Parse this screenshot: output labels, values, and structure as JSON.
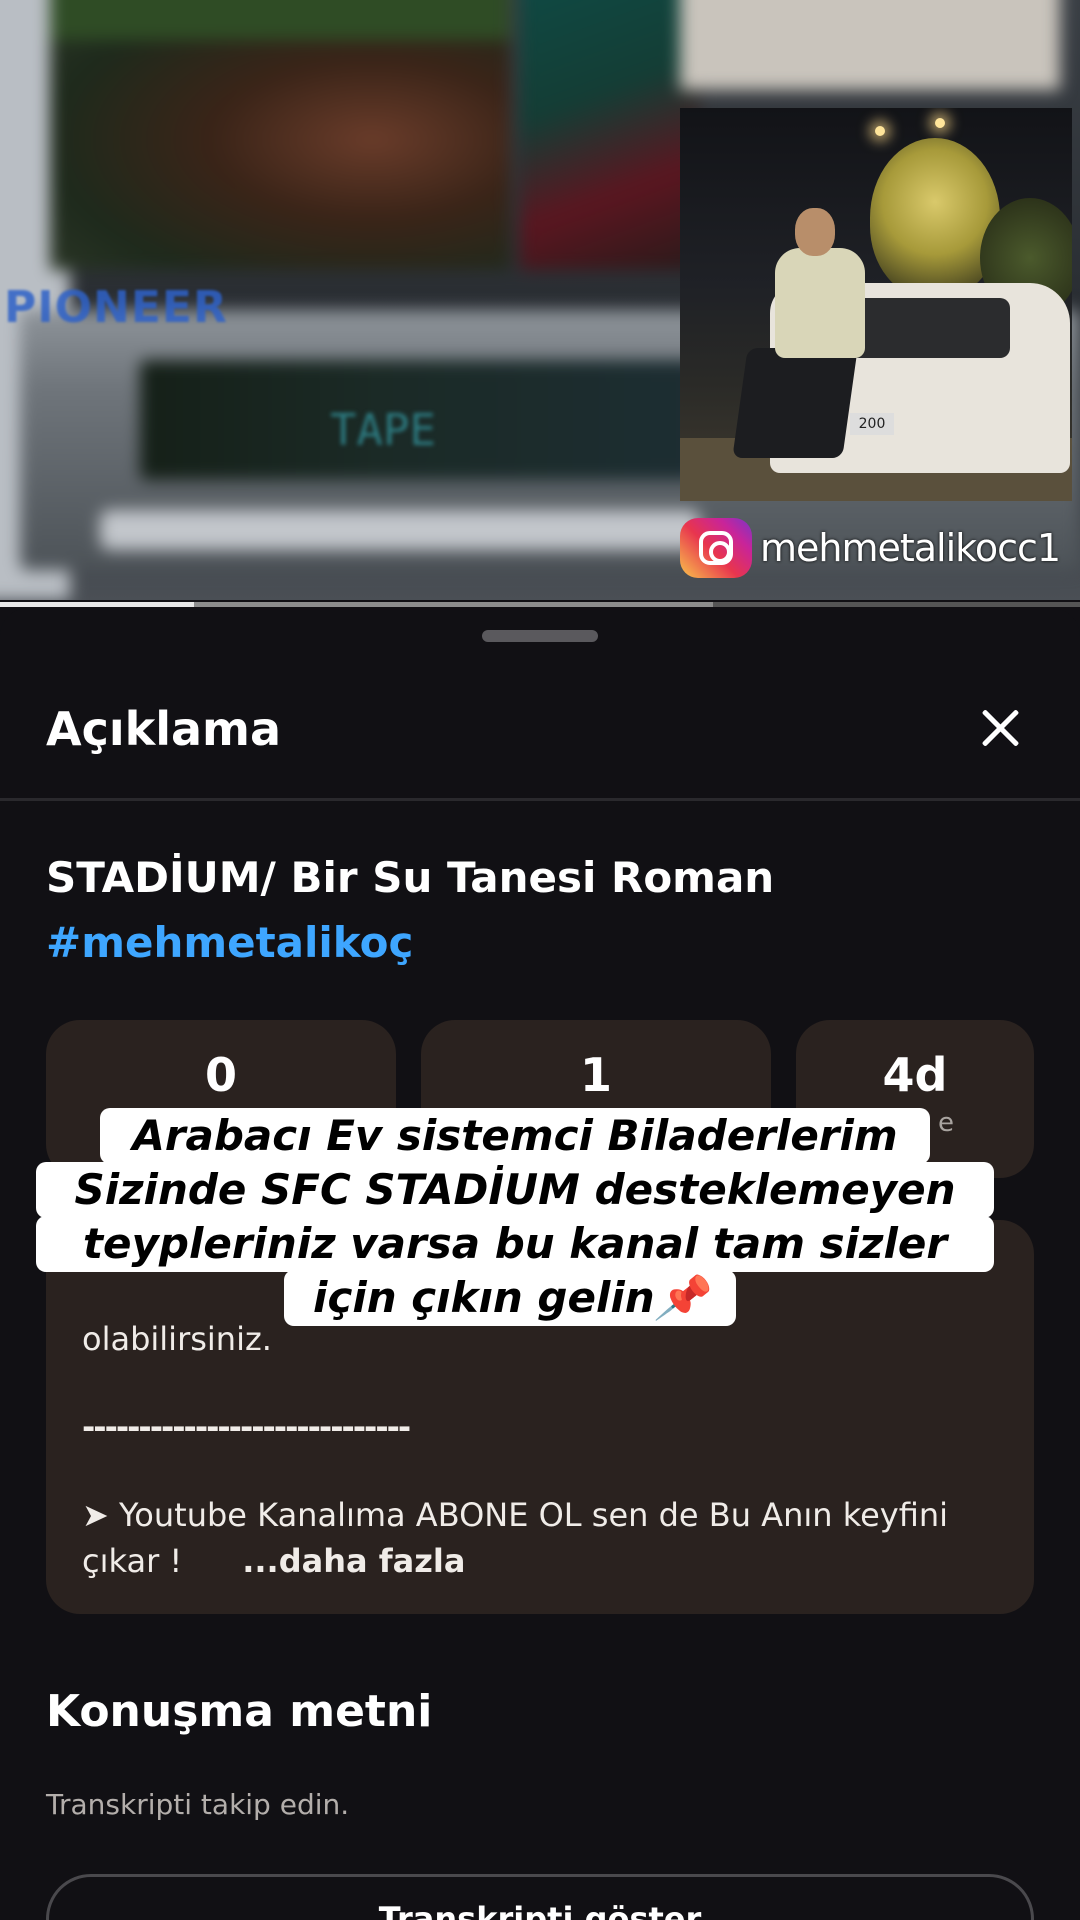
{
  "video": {
    "brand_text": "PIONEER",
    "display_text": "TAPE",
    "plate_text": "200",
    "instagram_handle": "mehmetalikocc1",
    "progress": 0.18,
    "buffered": 0.66
  },
  "sheet": {
    "title": "Açıklama",
    "video_title": "STADİUM/ Bir Su Tanesi Roman",
    "hashtag": "#mehmetalikoç",
    "stats": [
      {
        "value": "0",
        "label": ""
      },
      {
        "value": "1",
        "label": ""
      },
      {
        "value": "4d",
        "label": "e"
      }
    ],
    "description": {
      "line1": "olabilirsiniz.",
      "separator": "-----------------------------",
      "line2": "➤ Youtube Kanalıma ABONE OL sen de Bu Anın keyfini çıkar !",
      "more": "...daha fazla"
    },
    "transcript": {
      "title": "Konuşma metni",
      "subtitle": "Transkripti takip edin.",
      "button": "Transkripti göster"
    }
  },
  "caption": {
    "line1": "Arabacı Ev sistemci Biladerlerim",
    "line2": "Sizinde SFC STADİUM desteklemeyen",
    "line3": "teypleriniz varsa bu kanal tam sizler",
    "line4": "için çıkın gelin📌"
  },
  "colors": {
    "background": "#111014",
    "card": "#2a221f",
    "link": "#3ea6ff"
  }
}
